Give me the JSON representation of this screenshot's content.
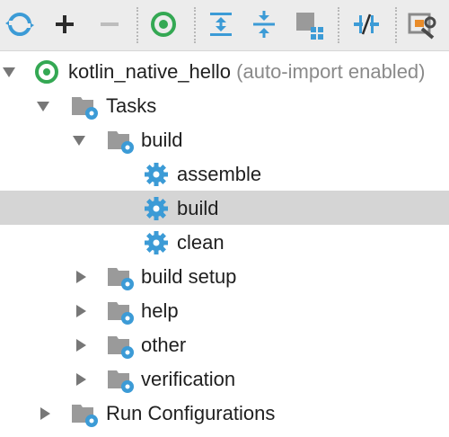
{
  "toolbar": {
    "buttons": [
      {
        "name": "refresh-all-icon"
      },
      {
        "name": "add-icon"
      },
      {
        "name": "remove-icon"
      },
      {
        "name": "execute-task-icon"
      },
      {
        "name": "expand-all-icon"
      },
      {
        "name": "collapse-all-icon"
      },
      {
        "name": "group-modules-icon"
      },
      {
        "name": "toggle-offline-icon"
      },
      {
        "name": "settings-icon"
      }
    ]
  },
  "tree": {
    "project": {
      "name": "kotlin_native_hello",
      "hint": "(auto-import enabled)"
    },
    "tasks_label": "Tasks",
    "build_group": "build",
    "build_tasks": [
      "assemble",
      "build",
      "clean"
    ],
    "other_groups": [
      "build setup",
      "help",
      "other",
      "verification"
    ],
    "run_configurations": "Run Configurations"
  },
  "colors": {
    "accent_blue": "#3c9bd6",
    "gradle_green": "#34a853",
    "selection": "#d5d5d5"
  }
}
